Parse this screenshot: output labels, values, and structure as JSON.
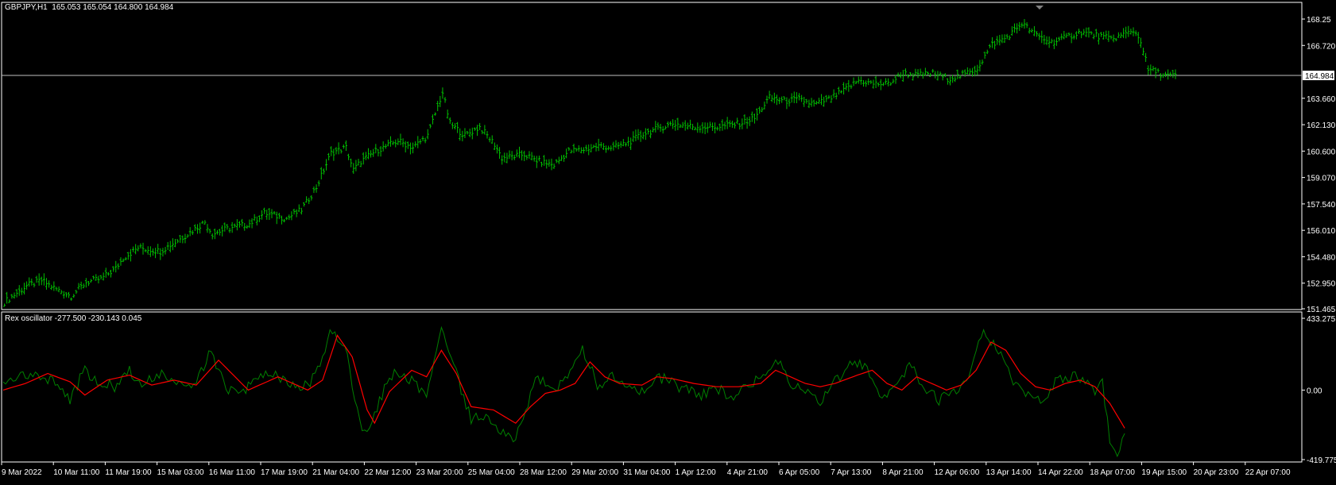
{
  "main_panel": {
    "info_label": "GBPJPY,H1  165.053 165.054 164.800 164.984",
    "current_price_label": "164.984"
  },
  "osc_panel": {
    "info_label": "Rex oscillator -277.500 -230.143 0.045"
  },
  "colors": {
    "background": "#000000",
    "bar": "#00c000",
    "rex_line": "#008000",
    "signal_line": "#ff0000",
    "frame": "#ffffff",
    "text": "#ffffff"
  },
  "chart_data": [
    {
      "type": "ohlc",
      "symbol": "GBPJPY",
      "timeframe": "H1",
      "ylim": [
        151.465,
        168.25
      ],
      "y_ticks": [
        {
          "value": 168.25,
          "label": "168.25"
        },
        {
          "value": 166.72,
          "label": "166.720"
        },
        {
          "value": 163.66,
          "label": "163.660"
        },
        {
          "value": 162.13,
          "label": "162.130"
        },
        {
          "value": 160.6,
          "label": "160.600"
        },
        {
          "value": 159.07,
          "label": "159.070"
        },
        {
          "value": 157.54,
          "label": "157.540"
        },
        {
          "value": 156.01,
          "label": "156.010"
        },
        {
          "value": 154.48,
          "label": "154.480"
        },
        {
          "value": 152.95,
          "label": "152.950"
        },
        {
          "value": 151.465,
          "label": "151.465"
        }
      ],
      "current_price": 164.984,
      "close_path": [
        [
          0,
          151.85
        ],
        [
          3,
          152.8
        ],
        [
          5,
          153.1
        ],
        [
          7,
          152.6
        ],
        [
          9,
          152.2
        ],
        [
          11,
          153.0
        ],
        [
          13,
          153.2
        ],
        [
          15,
          153.8
        ],
        [
          16,
          154.4
        ],
        [
          18,
          155.0
        ],
        [
          21,
          154.8
        ],
        [
          24,
          155.6
        ],
        [
          27,
          156.5
        ],
        [
          28,
          155.8
        ],
        [
          30,
          156.1
        ],
        [
          33,
          156.4
        ],
        [
          35,
          157.0
        ],
        [
          38,
          156.7
        ],
        [
          40,
          157.2
        ],
        [
          42,
          158.5
        ],
        [
          44,
          160.5
        ],
        [
          46,
          160.8
        ],
        [
          47,
          159.5
        ],
        [
          48,
          160.0
        ],
        [
          50,
          160.6
        ],
        [
          53,
          161.2
        ],
        [
          55,
          160.8
        ],
        [
          57,
          161.5
        ],
        [
          59,
          164.0
        ],
        [
          60,
          162.2
        ],
        [
          62,
          161.5
        ],
        [
          64,
          162.0
        ],
        [
          66,
          161.0
        ],
        [
          67,
          160.2
        ],
        [
          70,
          160.4
        ],
        [
          72,
          160.0
        ],
        [
          74,
          159.8
        ],
        [
          76,
          160.6
        ],
        [
          78,
          160.7
        ],
        [
          80,
          160.9
        ],
        [
          82,
          160.8
        ],
        [
          84,
          161.1
        ],
        [
          86,
          161.6
        ],
        [
          88,
          161.9
        ],
        [
          90,
          162.2
        ],
        [
          93,
          162.0
        ],
        [
          96,
          162.0
        ],
        [
          99,
          162.2
        ],
        [
          101,
          162.5
        ],
        [
          103,
          163.7
        ],
        [
          105,
          163.5
        ],
        [
          107,
          163.6
        ],
        [
          109,
          163.3
        ],
        [
          111,
          163.6
        ],
        [
          113,
          164.1
        ],
        [
          115,
          164.7
        ],
        [
          117,
          164.5
        ],
        [
          119,
          164.5
        ],
        [
          121,
          165.1
        ],
        [
          123,
          165.0
        ],
        [
          125,
          165.1
        ],
        [
          127,
          164.8
        ],
        [
          129,
          165.0
        ],
        [
          131,
          165.4
        ],
        [
          133,
          166.8
        ],
        [
          135,
          167.2
        ],
        [
          136,
          167.6
        ],
        [
          137,
          168.0
        ],
        [
          139,
          167.3
        ],
        [
          141,
          166.9
        ],
        [
          143,
          167.2
        ],
        [
          145,
          167.5
        ],
        [
          147,
          167.3
        ],
        [
          149,
          167.1
        ],
        [
          151,
          167.4
        ],
        [
          152,
          167.6
        ],
        [
          153,
          167.0
        ],
        [
          154,
          165.3
        ],
        [
          155,
          165.2
        ],
        [
          156,
          165.0
        ],
        [
          157,
          164.95
        ]
      ]
    },
    {
      "type": "line",
      "name": "Rex oscillator",
      "ylim": [
        -419.775,
        433.275
      ],
      "y_ticks": [
        {
          "value": 433.275,
          "label": "433.275"
        },
        {
          "value": 0,
          "label": "0.00"
        },
        {
          "value": -419.775,
          "label": "-419.775"
        }
      ],
      "rex_path": [
        [
          0,
          20
        ],
        [
          4,
          110
        ],
        [
          7,
          40
        ],
        [
          9,
          -60
        ],
        [
          11,
          130
        ],
        [
          12,
          60
        ],
        [
          15,
          20
        ],
        [
          17,
          120
        ],
        [
          19,
          30
        ],
        [
          21,
          100
        ],
        [
          24,
          20
        ],
        [
          26,
          60
        ],
        [
          28,
          240
        ],
        [
          30,
          0
        ],
        [
          32,
          -30
        ],
        [
          34,
          60
        ],
        [
          36,
          100
        ],
        [
          38,
          40
        ],
        [
          40,
          0
        ],
        [
          42,
          80
        ],
        [
          44,
          350
        ],
        [
          46,
          260
        ],
        [
          48,
          -180
        ],
        [
          49,
          -280
        ],
        [
          50,
          -150
        ],
        [
          52,
          100
        ],
        [
          55,
          60
        ],
        [
          57,
          -40
        ],
        [
          59,
          380
        ],
        [
          60,
          250
        ],
        [
          62,
          -50
        ],
        [
          63,
          -180
        ],
        [
          65,
          -150
        ],
        [
          67,
          -250
        ],
        [
          69,
          -300
        ],
        [
          70,
          -160
        ],
        [
          72,
          80
        ],
        [
          74,
          -20
        ],
        [
          76,
          80
        ],
        [
          78,
          240
        ],
        [
          79,
          160
        ],
        [
          80,
          30
        ],
        [
          82,
          80
        ],
        [
          84,
          40
        ],
        [
          86,
          -20
        ],
        [
          88,
          90
        ],
        [
          90,
          40
        ],
        [
          92,
          0
        ],
        [
          94,
          -30
        ],
        [
          96,
          20
        ],
        [
          98,
          -40
        ],
        [
          100,
          40
        ],
        [
          102,
          70
        ],
        [
          104,
          200
        ],
        [
          106,
          40
        ],
        [
          108,
          -20
        ],
        [
          110,
          -60
        ],
        [
          112,
          60
        ],
        [
          114,
          140
        ],
        [
          116,
          160
        ],
        [
          118,
          -40
        ],
        [
          120,
          20
        ],
        [
          122,
          160
        ],
        [
          124,
          20
        ],
        [
          126,
          -60
        ],
        [
          128,
          -20
        ],
        [
          130,
          60
        ],
        [
          131,
          220
        ],
        [
          132,
          360
        ],
        [
          134,
          240
        ],
        [
          136,
          40
        ],
        [
          138,
          -20
        ],
        [
          140,
          -60
        ],
        [
          142,
          60
        ],
        [
          144,
          80
        ],
        [
          146,
          60
        ],
        [
          147,
          -10
        ],
        [
          148,
          40
        ],
        [
          149,
          -300
        ],
        [
          150,
          -370
        ],
        [
          151,
          -260
        ]
      ],
      "signal_path": [
        [
          0,
          0
        ],
        [
          3,
          40
        ],
        [
          6,
          100
        ],
        [
          9,
          50
        ],
        [
          11,
          -30
        ],
        [
          14,
          60
        ],
        [
          17,
          90
        ],
        [
          20,
          30
        ],
        [
          23,
          60
        ],
        [
          26,
          30
        ],
        [
          29,
          180
        ],
        [
          31,
          90
        ],
        [
          33,
          0
        ],
        [
          35,
          40
        ],
        [
          37,
          80
        ],
        [
          39,
          40
        ],
        [
          41,
          0
        ],
        [
          43,
          60
        ],
        [
          45,
          330
        ],
        [
          47,
          200
        ],
        [
          49,
          -120
        ],
        [
          50,
          -200
        ],
        [
          52,
          -10
        ],
        [
          55,
          120
        ],
        [
          57,
          80
        ],
        [
          59,
          240
        ],
        [
          61,
          100
        ],
        [
          63,
          -100
        ],
        [
          66,
          -120
        ],
        [
          69,
          -200
        ],
        [
          71,
          -100
        ],
        [
          73,
          -20
        ],
        [
          75,
          0
        ],
        [
          77,
          40
        ],
        [
          79,
          170
        ],
        [
          81,
          80
        ],
        [
          83,
          40
        ],
        [
          86,
          30
        ],
        [
          88,
          80
        ],
        [
          90,
          70
        ],
        [
          93,
          40
        ],
        [
          96,
          20
        ],
        [
          99,
          20
        ],
        [
          102,
          40
        ],
        [
          104,
          120
        ],
        [
          106,
          80
        ],
        [
          108,
          40
        ],
        [
          110,
          20
        ],
        [
          112,
          40
        ],
        [
          115,
          90
        ],
        [
          117,
          120
        ],
        [
          119,
          40
        ],
        [
          121,
          0
        ],
        [
          123,
          80
        ],
        [
          125,
          40
        ],
        [
          127,
          0
        ],
        [
          129,
          30
        ],
        [
          131,
          120
        ],
        [
          133,
          290
        ],
        [
          135,
          240
        ],
        [
          137,
          100
        ],
        [
          139,
          20
        ],
        [
          141,
          0
        ],
        [
          143,
          40
        ],
        [
          145,
          60
        ],
        [
          147,
          20
        ],
        [
          149,
          -80
        ],
        [
          151,
          -230
        ]
      ]
    }
  ],
  "x_axis": {
    "labels": [
      "9 Mar 2022",
      "10 Mar 11:00",
      "11 Mar 19:00",
      "15 Mar 03:00",
      "16 Mar 11:00",
      "17 Mar 19:00",
      "21 Mar 04:00",
      "22 Mar 12:00",
      "23 Mar 20:00",
      "25 Mar 04:00",
      "28 Mar 12:00",
      "29 Mar 20:00",
      "31 Mar 04:00",
      "1 Apr 12:00",
      "4 Apr 21:00",
      "6 Apr 05:00",
      "7 Apr 13:00",
      "8 Apr 21:00",
      "12 Apr 06:00",
      "13 Apr 14:00",
      "14 Apr 22:00",
      "18 Apr 07:00",
      "19 Apr 15:00",
      "20 Apr 23:00",
      "22 Apr 07:00"
    ]
  }
}
